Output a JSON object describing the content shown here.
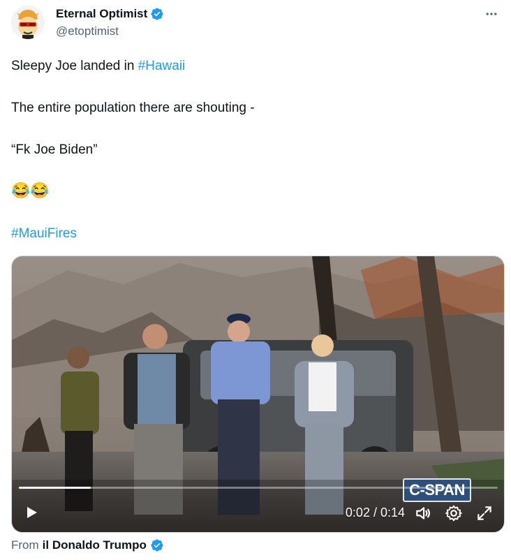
{
  "author": {
    "display_name": "Eternal Optimist",
    "handle": "@etoptimist",
    "verified": true,
    "avatar_icon": "bull-avatar-icon"
  },
  "more_icon": "more-options-icon",
  "tweet": {
    "line1_prefix": "Sleepy Joe landed in ",
    "line1_hashtag": "#Hawaii",
    "line2": "The entire population there are shouting -",
    "line3": "“Fk Joe Biden”",
    "emojis": "😂😂",
    "line5_hashtag": "#MauiFires"
  },
  "video": {
    "watermark": "C-SPAN",
    "current_time": "0:02",
    "duration": "0:14",
    "time_display": "0:02 / 0:14",
    "progress": 0.15,
    "controls": [
      "play-icon",
      "volume-icon",
      "settings-icon",
      "fullscreen-icon"
    ]
  },
  "attribution": {
    "prefix": "From",
    "source_name": "il Donaldo Trumpo",
    "verified": true
  },
  "colors": {
    "link": "#1d9bf0",
    "text": "#0f1419",
    "secondary": "#536471",
    "verified": "#1d9bf0"
  }
}
